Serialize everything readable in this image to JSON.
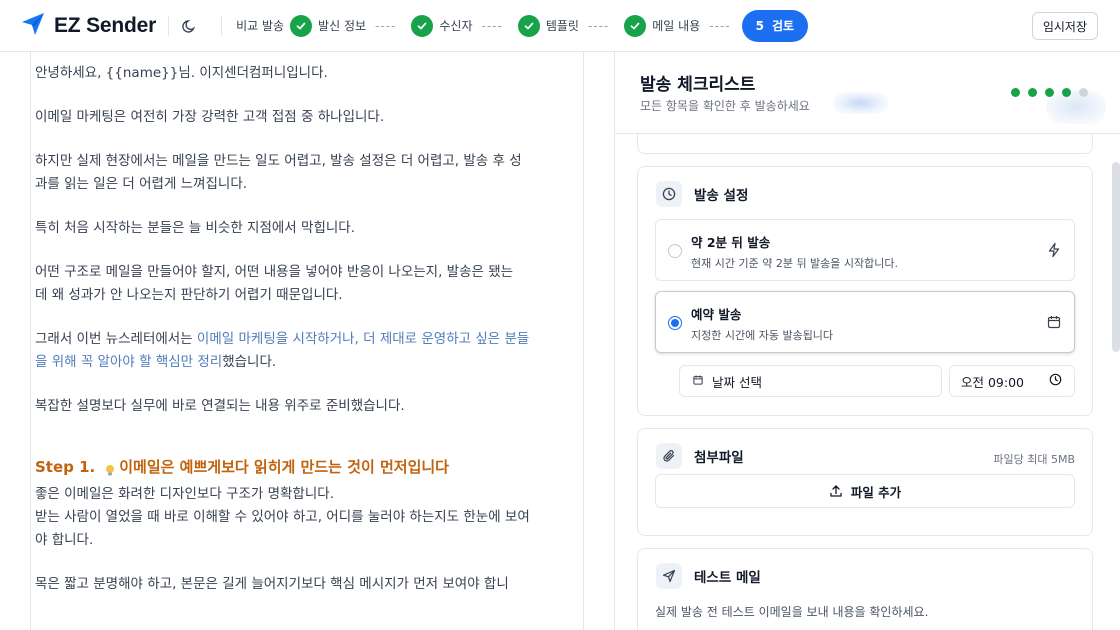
{
  "header": {
    "brand": "EZ Sender",
    "steps": [
      {
        "label": "비교 발송",
        "state": "plain"
      },
      {
        "label": "발신 정보",
        "state": "done"
      },
      {
        "label": "수신자",
        "state": "done"
      },
      {
        "label": "템플릿",
        "state": "done"
      },
      {
        "label": "메일 내용",
        "state": "done"
      }
    ],
    "current_step": {
      "number": "5",
      "label": "검토"
    },
    "save_label": "임시저장"
  },
  "content": {
    "greeting": "안녕하세요, {{name}}님. 이지센더컴퍼니입니다.",
    "p1": "이메일 마케팅은 여전히 가장 강력한 고객 접점 중 하나입니다.",
    "p2_line1": "하지만 실제 현장에서는 메일을 만드는 일도 어렵고, 발송 설정은 더 어렵고, 발송 후 성",
    "p2_line2": "과를 읽는 일은 더 어렵게 느껴집니다.",
    "p3": "특히 처음 시작하는 분들은 늘 비슷한 지점에서 막힙니다.",
    "p4_line1": "어떤 구조로 메일을 만들어야 할지, 어떤 내용을 넣어야 반응이 나오는지, 발송은 됐는",
    "p4_line2": "데 왜 성과가 안 나오는지 판단하기 어렵기 때문입니다.",
    "p5_prefix": "그래서 이번 뉴스레터에서는 ",
    "p5_link_line1": "이메일 마케팅을 시작하거나, 더 제대로 운영하고 싶은 분들",
    "p5_link_line2": "을 위해 꼭 알아야 할 핵심만 정리",
    "p5_suffix": "했습니다.",
    "p6": "복잡한 설명보다 실무에 바로 연결되는 내용 위주로 준비했습니다.",
    "step1_prefix": "Step 1.",
    "step1_title": "이메일은 예쁘게보다 읽히게 만드는 것이 먼저입니다",
    "step1_l1": "좋은 이메일은 화려한 디자인보다 구조가 명확합니다.",
    "step1_l2": "받는 사람이 열었을 때 바로 이해할 수 있어야 하고, 어디를 눌러야 하는지도 한눈에 보여",
    "step1_l3": "야 합니다.",
    "cut_line": "목은 짧고 분명해야 하고, 본문은 길게 늘어지기보다 핵심 메시지가 먼저 보여야 합니"
  },
  "checklist": {
    "title": "발송 체크리스트",
    "subtitle": "모든 항목을 확인한 후 발송하세요",
    "progress_done": 4,
    "progress_total": 5,
    "send_settings": {
      "title": "발송 설정",
      "option1": {
        "title": "약 2분 뒤 발송",
        "desc": "현재 시간 기준 약 2분 뒤 발송을 시작합니다."
      },
      "option2": {
        "title": "예약 발송",
        "desc": "지정한 시간에 자동 발송됩니다"
      },
      "selected": "option2",
      "date_placeholder": "날짜 선택",
      "time_value": "오전 09:00"
    },
    "attachment": {
      "title": "첨부파일",
      "note": "파일당 최대 5MB",
      "add_label": "파일 추가"
    },
    "test_mail": {
      "title": "테스트 메일",
      "desc": "실제 발송 전 테스트 이메일을 보내 내용을 확인하세요."
    }
  },
  "colors": {
    "accent": "#1d6ff2",
    "done": "#16a34a",
    "step_heading": "#c2620c",
    "link": "#4f7dbb"
  }
}
